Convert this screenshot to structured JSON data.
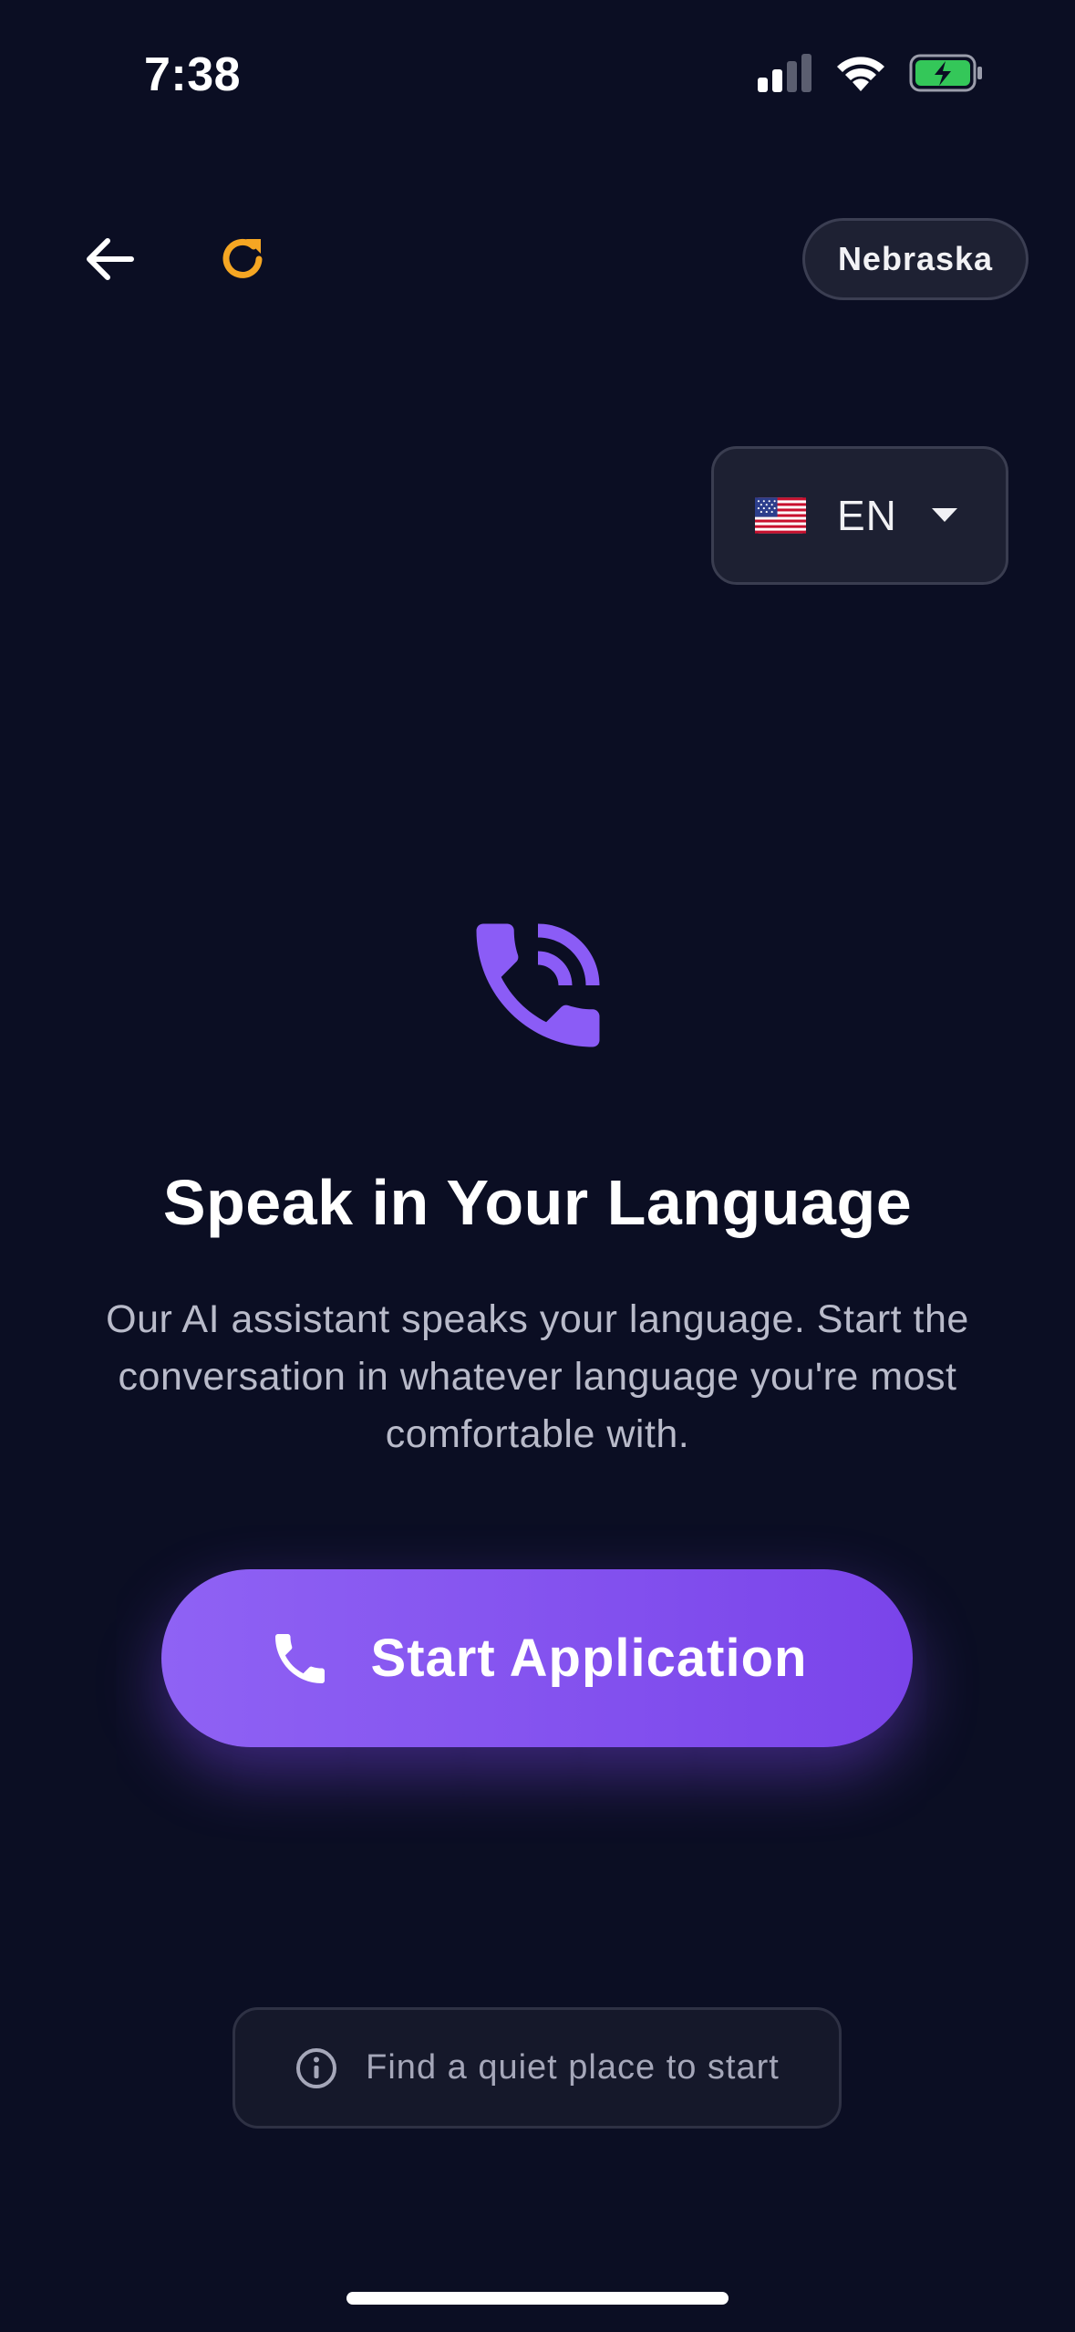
{
  "status_bar": {
    "time": "7:38",
    "signal_icon": "cellular-signal-icon",
    "wifi_icon": "wifi-icon",
    "battery_icon": "battery-charging-icon",
    "battery_color": "#34c759"
  },
  "header": {
    "back_icon": "arrow-left-icon",
    "refresh_icon": "refresh-icon",
    "refresh_color": "#f5a623",
    "state_label": "Nebraska"
  },
  "language_selector": {
    "flag_icon": "us-flag-icon",
    "code": "EN",
    "caret_icon": "caret-down-icon"
  },
  "hero": {
    "icon": "phone-in-talk-icon",
    "icon_color": "#8b5cf6",
    "title": "Speak in Your Language",
    "description": "Our AI assistant speaks your language. Start the conversation in whatever language you're most comfortable with."
  },
  "cta": {
    "label": "Start Application",
    "icon": "phone-icon",
    "gradient_start": "#8f62f4",
    "gradient_end": "#7a44ea"
  },
  "tip": {
    "icon": "info-icon",
    "text": "Find a quiet place to start"
  }
}
